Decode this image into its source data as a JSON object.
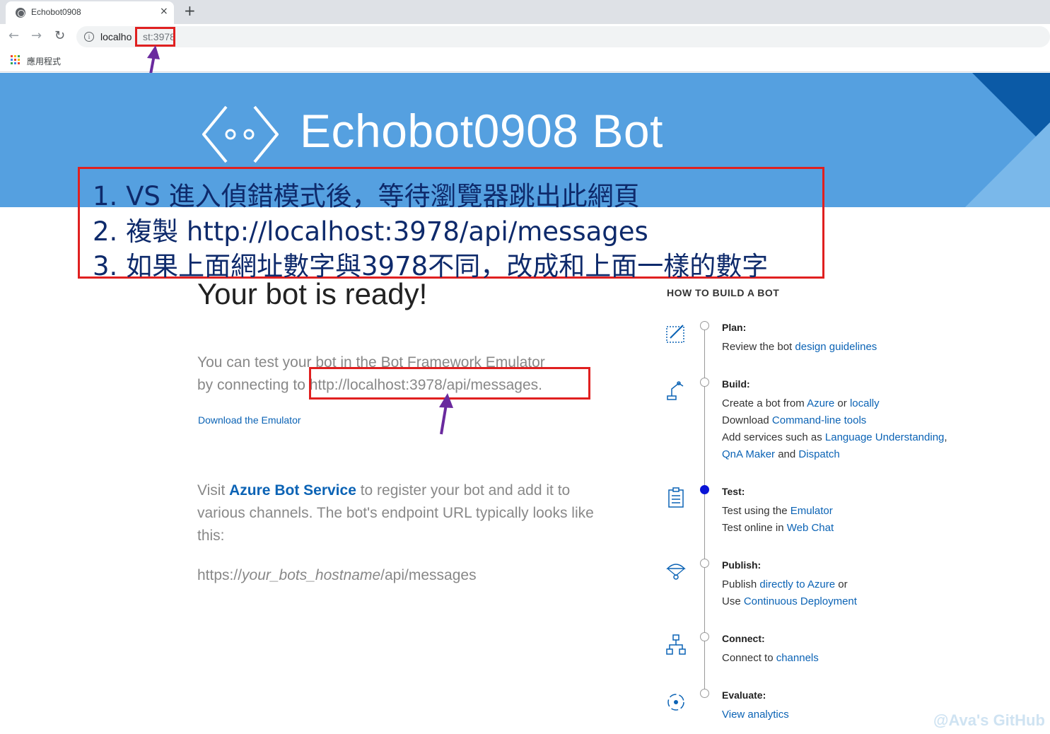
{
  "browser": {
    "tab_title": "Echobot0908",
    "tab_close": "×",
    "new_tab": "+",
    "url_host": "localho",
    "url_port": "st:3978",
    "bookmarks_label": "應用程式"
  },
  "banner": {
    "title": "Echobot0908 Bot"
  },
  "annotation": {
    "lines": [
      "1. VS 進入偵錯模式後，等待瀏覽器跳出此網頁",
      "2. 複製 http://localhost:3978/api/messages",
      "3. 如果上面網址數字與3978不同，改成和上面一樣的數字"
    ]
  },
  "main": {
    "title": "Your bot is ready!",
    "intro_line1": "You can test your bot in the Bot Framework Emulator",
    "intro_line2_prefix": "by connecting to ",
    "intro_url": "http://localhost:3978/api/messages.",
    "download_link": "Download the Emulator",
    "visit_prefix": "Visit ",
    "visit_link": "Azure Bot Service",
    "visit_rest": " to register your bot and add it to various channels. The bot's endpoint URL typically looks like this:",
    "endpoint_prefix": "https://",
    "endpoint_italic": "your_bots_hostname",
    "endpoint_suffix": "/api/messages"
  },
  "howto": {
    "title": "HOW TO BUILD A BOT",
    "steps": [
      {
        "name": "Plan:",
        "icon": "pencil-canvas-icon",
        "active": false
      },
      {
        "name": "Build:",
        "icon": "robot-arm-icon",
        "active": false
      },
      {
        "name": "Test:",
        "icon": "clipboard-checklist-icon",
        "active": true
      },
      {
        "name": "Publish:",
        "icon": "parachute-icon",
        "active": false
      },
      {
        "name": "Connect:",
        "icon": "network-icon",
        "active": false
      },
      {
        "name": "Evaluate:",
        "icon": "analytics-cycle-icon",
        "active": false
      }
    ],
    "plan": {
      "text": "Review the bot ",
      "link": "design guidelines"
    },
    "build": {
      "l1_a": "Create a bot from ",
      "l1_link1": "Azure",
      "l1_b": " or ",
      "l1_link2": "locally",
      "l2_a": "Download ",
      "l2_link": "Command-line tools",
      "l3_a": "Add services such as ",
      "l3_link": "Language Understanding",
      "l3_b": ",",
      "l4_link1": "QnA Maker",
      "l4_a": " and ",
      "l4_link2": "Dispatch"
    },
    "test": {
      "l1_a": "Test using the ",
      "l1_link": "Emulator",
      "l2_a": "Test online in ",
      "l2_link": "Web Chat"
    },
    "publish": {
      "l1_a": "Publish ",
      "l1_link": "directly to Azure",
      "l1_b": " or",
      "l2_a": "Use ",
      "l2_link": "Continuous Deployment"
    },
    "connect": {
      "a": "Connect to ",
      "link": "channels"
    },
    "evaluate": {
      "link": "View analytics"
    }
  },
  "watermark": "@Ava's GitHub",
  "colors": {
    "banner": "#55a0e0",
    "link": "#0b63b5",
    "annotation_border": "#e02020",
    "annotation_text": "#0e2a6b",
    "arrow": "#6a2a9e",
    "active_dot": "#0a14d6"
  }
}
